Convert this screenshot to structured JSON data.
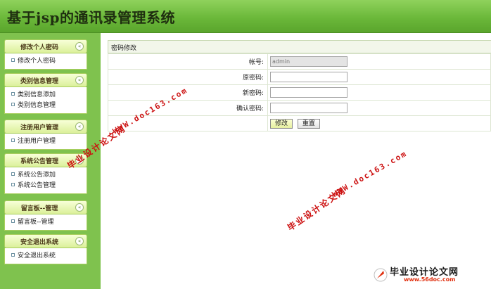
{
  "header": {
    "title": "基于jsp的通讯录管理系统"
  },
  "sidebar": {
    "groups": [
      {
        "title": "修改个人密码",
        "items": [
          "修改个人密码"
        ]
      },
      {
        "title": "类别信息管理",
        "items": [
          "类别信息添加",
          "类别信息管理"
        ]
      },
      {
        "title": "注册用户管理",
        "items": [
          "注册用户管理"
        ]
      },
      {
        "title": "系统公告管理",
        "items": [
          "系统公告添加",
          "系统公告管理"
        ]
      },
      {
        "title": "留言板--管理",
        "items": [
          "留言板--管理"
        ]
      },
      {
        "title": "安全退出系统",
        "items": [
          "安全退出系统"
        ]
      }
    ],
    "toggle_glyph": "«"
  },
  "main": {
    "panel_title": "密码修改",
    "fields": {
      "account_label": "帐号:",
      "account_value": "admin",
      "old_pw_label": "原密码:",
      "new_pw_label": "新密码:",
      "confirm_pw_label": "确认密码:"
    },
    "buttons": {
      "submit": "修改",
      "reset": "重置"
    }
  },
  "watermarks": {
    "zh": "毕业设计论文网",
    "en": "WWW.doc163.com"
  },
  "footer": {
    "logo_text": "毕业设计论文网",
    "url": "www.56doc.com"
  },
  "colors": {
    "header_green": "#6bb83a",
    "sidebar_green": "#7fc24e",
    "watermark_red": "#cc1010"
  }
}
